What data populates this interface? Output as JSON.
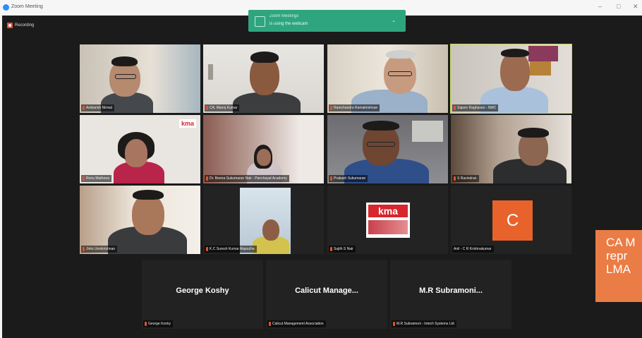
{
  "window": {
    "title": "Zoom Meeting",
    "controls": [
      "–",
      "□",
      "✕"
    ]
  },
  "recording": {
    "label": "Recording"
  },
  "toast": {
    "title": "Zoom Meetings",
    "text": "is using the webcam",
    "icon": "camera-icon"
  },
  "participants": [
    {
      "name": "Ambarish Nirmal",
      "active": false
    },
    {
      "name": "CA. Manoj Kumar",
      "active": false
    },
    {
      "name": "Ramchandra Ramakrishnan",
      "active": false
    },
    {
      "name": "Sajeev Raghavan - NMC",
      "active": true
    },
    {
      "name": "Renu Mathews",
      "active": false
    },
    {
      "name": "Dr. Beena Sukumaran Nair - Panchayat Academy",
      "active": false
    },
    {
      "name": "Prakash Sukumaran",
      "active": false
    },
    {
      "name": "S Ravindran",
      "active": false
    },
    {
      "name": "Jinto Unnikrishnan",
      "active": false
    },
    {
      "name": "K.C Suresh Kumar Alapuzha",
      "active": false
    },
    {
      "name": "Sujith S Nair",
      "active": false
    },
    {
      "name": "Anil - C R Krishnakumar",
      "active": false
    },
    {
      "name": "George Koshy",
      "display_name": "George Koshy",
      "active": false
    },
    {
      "name": "Calicut Management Association",
      "display_name": "Calicut  Manage...",
      "active": false
    },
    {
      "name": "M.R Subramoni - Intech Systems Ltd",
      "display_name": "M.R Subramoni...",
      "active": false
    }
  ],
  "avatar_letter": "C",
  "logo_text": "kma",
  "overlay": {
    "lines": [
      "CA M",
      "repr",
      "LMA"
    ]
  },
  "colors": {
    "accent": "#2fa57f",
    "active_speaker": "#c9dc55",
    "avatar": "#e8632b",
    "overlay": "#ea7c45"
  }
}
